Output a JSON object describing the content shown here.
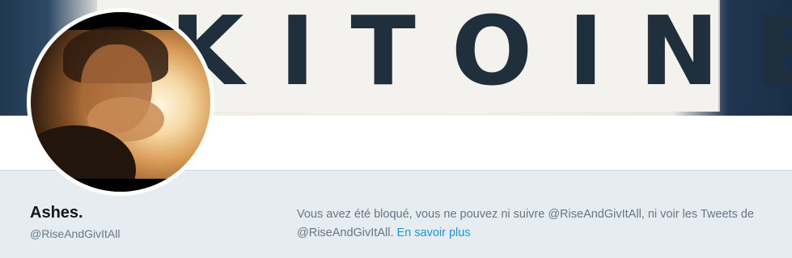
{
  "banner": {
    "text": "KITOINE"
  },
  "profile": {
    "name": "Ashes.",
    "handle": "@RiseAndGivItAll"
  },
  "blocked": {
    "message": "Vous avez été bloqué, vous ne pouvez ni suivre @RiseAndGivItAll, ni voir les Tweets de @RiseAndGivItAll.",
    "link_label": "En savoir plus"
  },
  "colors": {
    "link": "#1b95e0",
    "muted_text": "#657786",
    "name_text": "#14171a",
    "page_background": "#e6ecf0"
  }
}
